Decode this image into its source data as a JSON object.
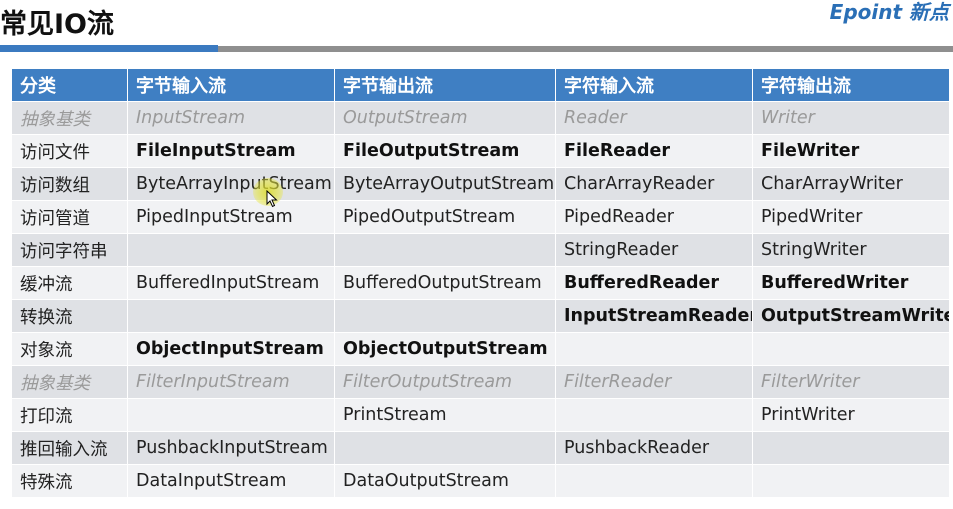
{
  "title": "常见IO流",
  "logo": "Epoint 新点",
  "table": {
    "headers": [
      "分类",
      "字节输入流",
      "字节输出流",
      "字符输入流",
      "字符输出流"
    ],
    "rows": [
      {
        "style": "italic",
        "cells": [
          "抽象基类",
          "InputStream",
          "OutputStream",
          "Reader",
          "Writer"
        ]
      },
      {
        "style": "mixed",
        "cells": [
          "访问文件",
          "FileInputStream",
          "FileOutputStream",
          "FileReader",
          "FileWriter"
        ],
        "bold": [
          false,
          true,
          true,
          true,
          true
        ]
      },
      {
        "style": "normal",
        "cells": [
          "访问数组",
          "ByteArrayInputStream",
          "ByteArrayOutputStream",
          "CharArrayReader",
          "CharArrayWriter"
        ]
      },
      {
        "style": "normal",
        "cells": [
          "访问管道",
          "PipedInputStream",
          "PipedOutputStream",
          "PipedReader",
          "PipedWriter"
        ]
      },
      {
        "style": "normal",
        "cells": [
          "访问字符串",
          "",
          "",
          "StringReader",
          "StringWriter"
        ]
      },
      {
        "style": "mixed",
        "cells": [
          "缓冲流",
          "BufferedInputStream",
          "BufferedOutputStream",
          "BufferedReader",
          "BufferedWriter"
        ],
        "bold": [
          false,
          false,
          false,
          true,
          true
        ]
      },
      {
        "style": "mixed",
        "cells": [
          "转换流",
          "",
          "",
          "InputStreamReader",
          "OutputStreamWriter"
        ],
        "bold": [
          false,
          false,
          false,
          true,
          true
        ]
      },
      {
        "style": "mixed",
        "cells": [
          "对象流",
          "ObjectInputStream",
          "ObjectOutputStream",
          "",
          ""
        ],
        "bold": [
          false,
          true,
          true,
          false,
          false
        ]
      },
      {
        "style": "italic",
        "cells": [
          "抽象基类",
          "FilterInputStream",
          "FilterOutputStream",
          "FilterReader",
          "FilterWriter"
        ]
      },
      {
        "style": "normal",
        "cells": [
          "打印流",
          "",
          "PrintStream",
          "",
          "PrintWriter"
        ]
      },
      {
        "style": "normal",
        "cells": [
          "推回输入流",
          "PushbackInputStream",
          "",
          "PushbackReader",
          ""
        ]
      },
      {
        "style": "normal",
        "cells": [
          "特殊流",
          "DataInputStream",
          "DataOutputStream",
          "",
          ""
        ]
      }
    ]
  },
  "colors": {
    "header_bg": "#3f7fc3",
    "row_odd": "#dfe1e5",
    "row_even": "#f1f2f4",
    "rule_blue": "#3b7ac0",
    "rule_gray": "#8f8f8f",
    "logo": "#2a6fb6"
  },
  "icons": [
    "mouse-cursor-icon"
  ]
}
